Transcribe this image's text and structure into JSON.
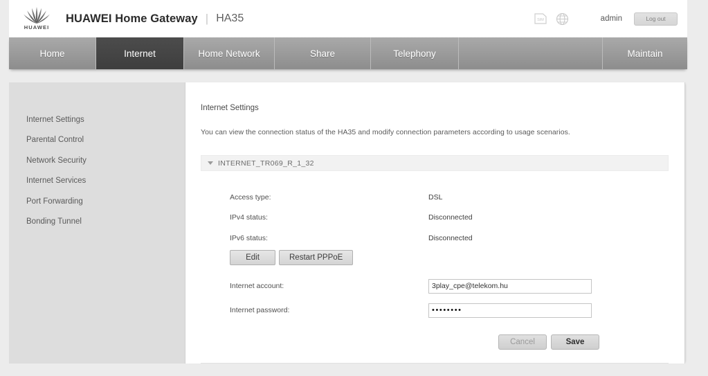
{
  "header": {
    "logo_word": "HUAWEI",
    "brand_title": "HUAWEI Home Gateway",
    "separator": "|",
    "model": "HA35",
    "sim_icon": "sim-card-icon",
    "sim_icon_text": "SIM",
    "globe_icon": "globe-icon",
    "user": "admin",
    "logout_label": "Log out"
  },
  "nav": {
    "tabs": [
      {
        "label": "Home",
        "active": false
      },
      {
        "label": "Internet",
        "active": true
      },
      {
        "label": "Home Network",
        "active": false
      },
      {
        "label": "Share",
        "active": false
      },
      {
        "label": "Telephony",
        "active": false
      },
      {
        "label": "",
        "active": false
      },
      {
        "label": "Maintain",
        "active": false
      }
    ]
  },
  "sidebar": {
    "items": [
      {
        "label": "Internet Settings"
      },
      {
        "label": "Parental Control"
      },
      {
        "label": "Network Security"
      },
      {
        "label": "Internet Services"
      },
      {
        "label": "Port Forwarding"
      },
      {
        "label": "Bonding Tunnel"
      }
    ]
  },
  "main": {
    "title": "Internet Settings",
    "description": "You can view the connection status of the HA35 and modify connection parameters according to usage scenarios.",
    "section": {
      "name": "INTERNET_TR069_R_1_32",
      "caret_icon": "chevron-down-icon"
    },
    "fields": [
      {
        "label": "Access type:",
        "value": "DSL"
      },
      {
        "label": "IPv4 status:",
        "value": "Disconnected"
      },
      {
        "label": "IPv6 status:",
        "value": "Disconnected"
      }
    ],
    "buttons": {
      "edit": "Edit",
      "restart_pppoe": "Restart PPPoE"
    },
    "inputs": [
      {
        "label": "Internet account:",
        "value": "3play_cpe@telekom.hu",
        "type": "text"
      },
      {
        "label": "Internet password:",
        "value": "••••••••",
        "type": "password"
      }
    ],
    "actions": {
      "cancel": "Cancel",
      "save": "Save"
    }
  },
  "colors": {
    "page_bg": "#ececec",
    "nav_active": "#434343",
    "nav_inactive": "#9b9b9b",
    "sidebar_bg": "#dddddd",
    "content_bg": "#ffffff"
  }
}
